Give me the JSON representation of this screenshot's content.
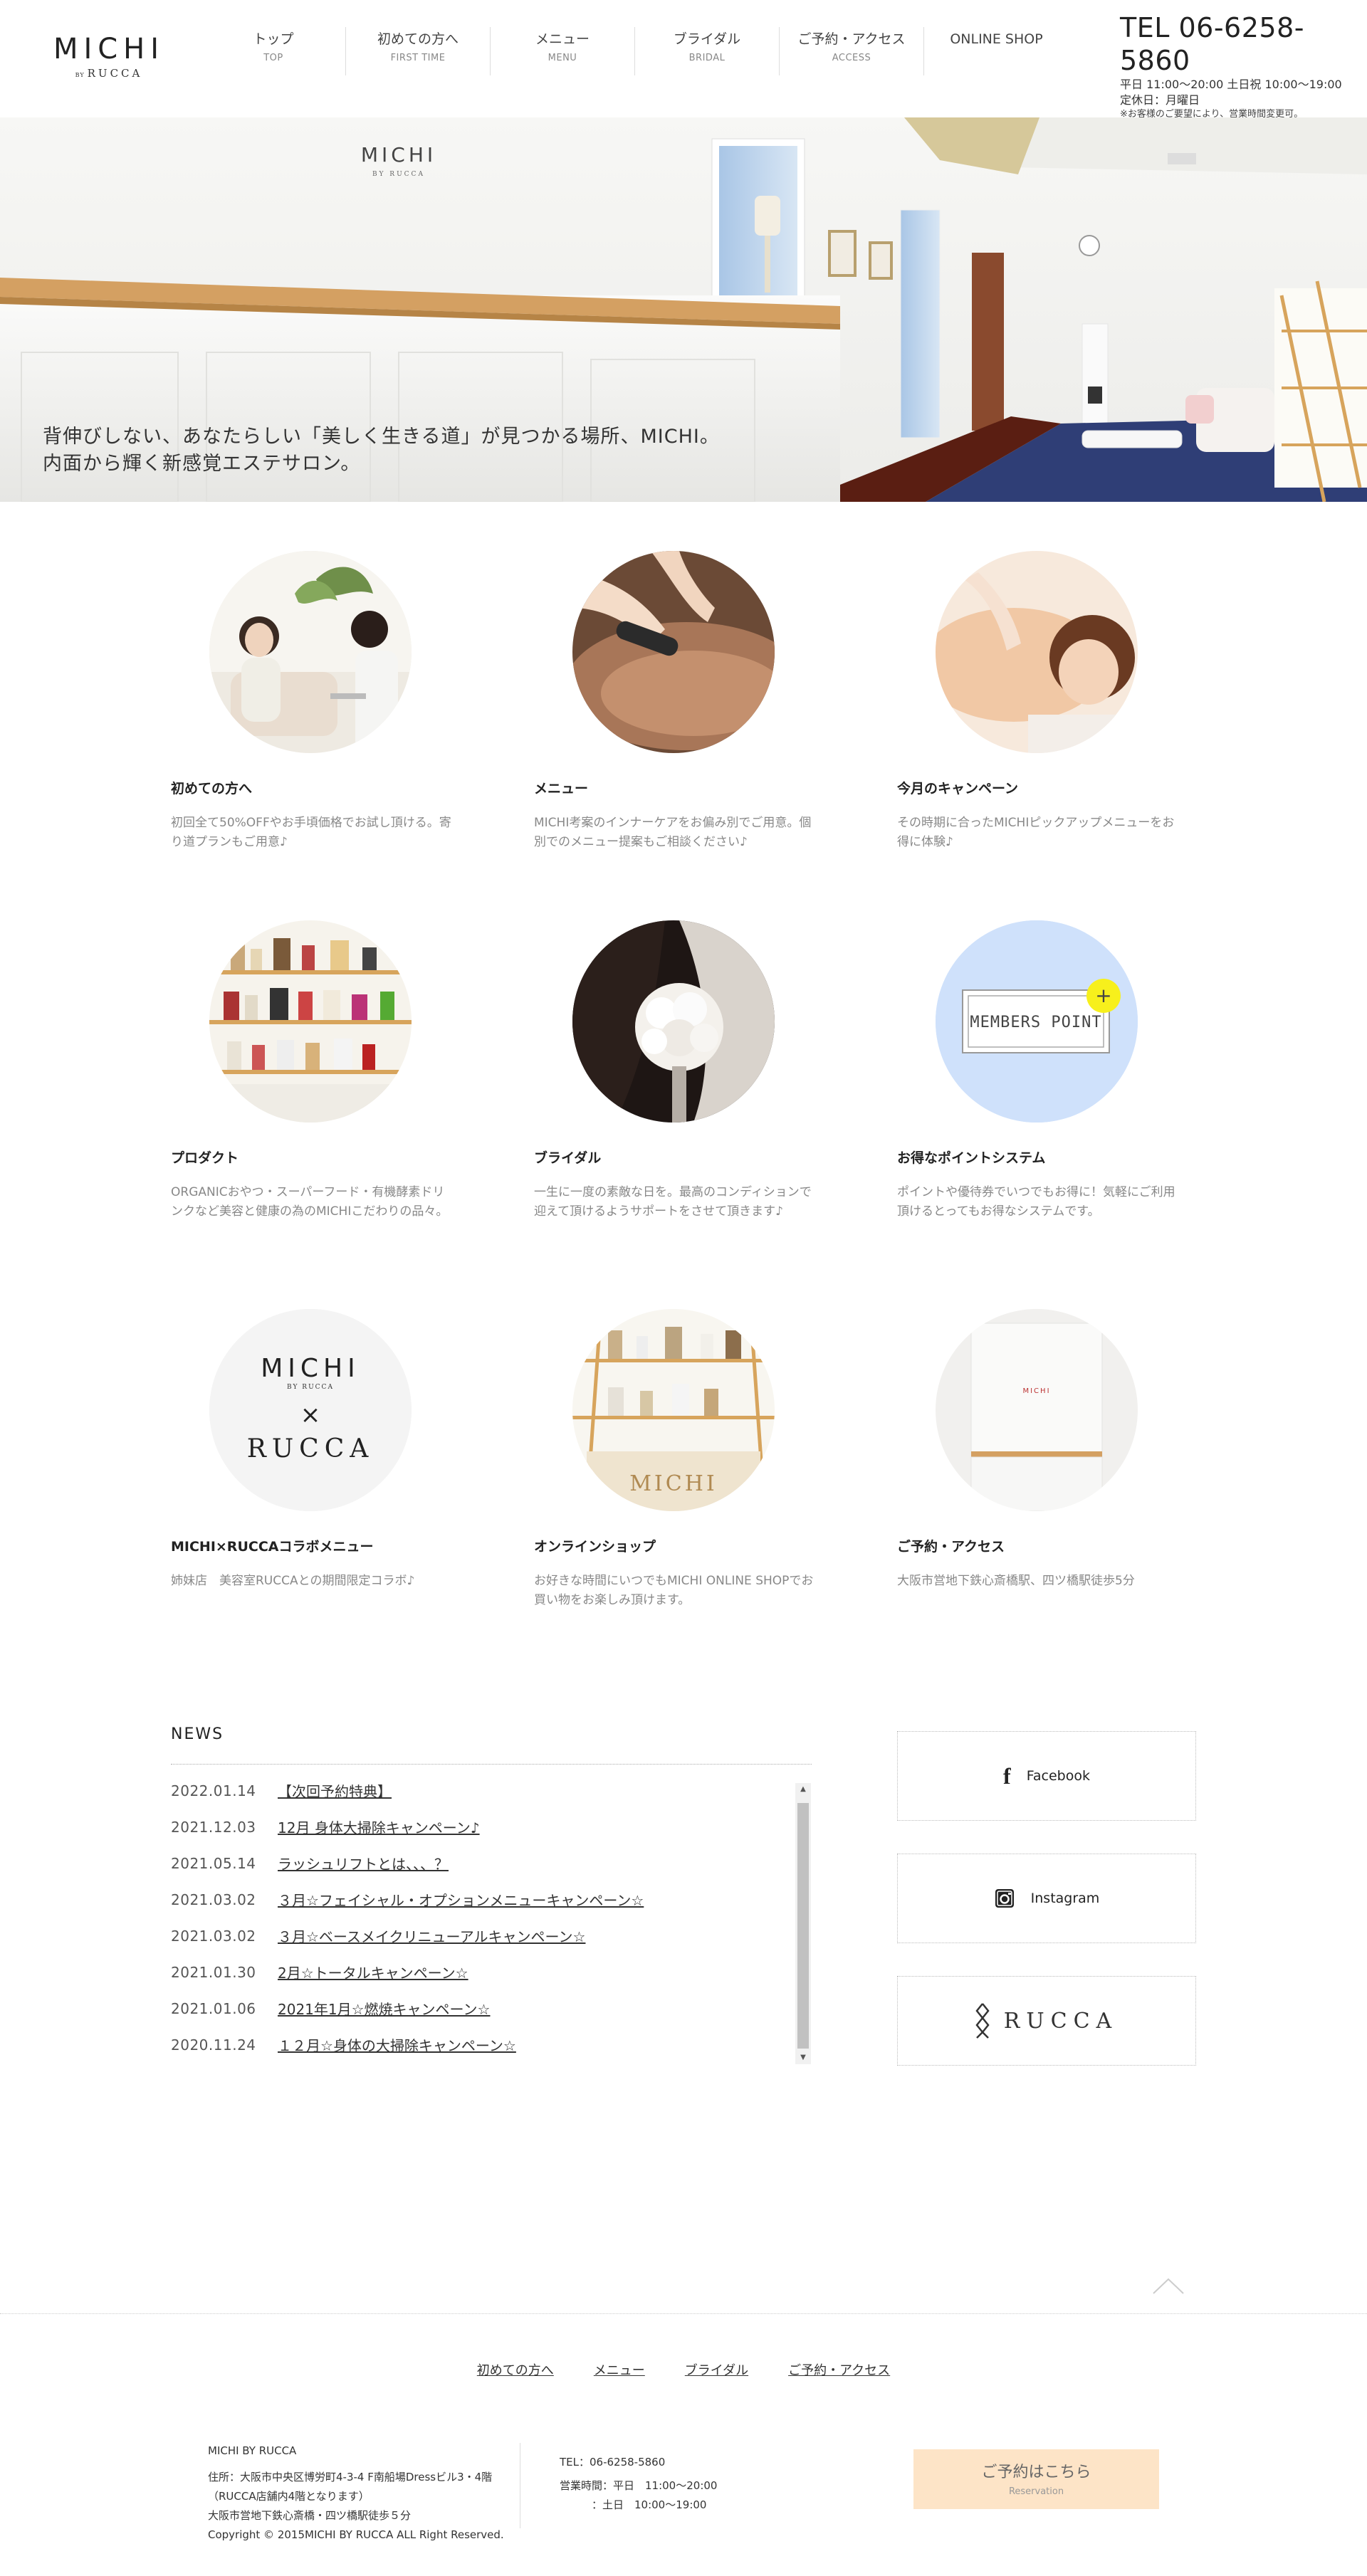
{
  "header": {
    "logo": "MICHI",
    "logo_by": "BY",
    "logo_sub": "RUCCA",
    "nav": [
      {
        "jp": "トップ",
        "en": "TOP"
      },
      {
        "jp": "初めての方へ",
        "en": "FIRST TIME"
      },
      {
        "jp": "メニュー",
        "en": "MENU"
      },
      {
        "jp": "ブライダル",
        "en": "BRIDAL"
      },
      {
        "jp": "ご予約・アクセス",
        "en": "ACCESS"
      },
      {
        "jp": "ONLINE SHOP",
        "en": ""
      }
    ],
    "tel": "TEL 06-6258-5860",
    "hours": "平日 11:00〜20:00 土日祝 10:00〜19:00",
    "holiday": "定休日：月曜日",
    "note": "※お客様のご要望により、営業時間変更可。"
  },
  "hero": {
    "wall_logo": "MICHI",
    "wall_logo_sub": "BY RUCCA",
    "line1": "背伸びしない、あなたらしい「美しく生きる道」が見つかる場所、MICHI。",
    "line2": "内面から輝く新感覚エステサロン。"
  },
  "grid": [
    {
      "title": "初めての方へ",
      "desc": "初回全て50%OFFやお手頃価格でお試し頂ける。寄り道プランもご用意♪"
    },
    {
      "title": "メニュー",
      "desc": "MICHI考案のインナーケアをお偏み別でご用意。個別でのメニュー提案もご相談ください♪"
    },
    {
      "title": "今月のキャンペーン",
      "desc": "その時期に合ったMICHIピックアップメニューをお得に体験♪"
    },
    {
      "title": "プロダクト",
      "desc": "ORGANICおやつ・スーパーフード・有機酵素ドリンクなど美容と健康の為のMICHIこだわりの品々。"
    },
    {
      "title": "ブライダル",
      "desc": "一生に一度の素敵な日を。最高のコンディションで迎えて頂けるようサポートをさせて頂きます♪"
    },
    {
      "title": "お得なポイントシステム",
      "desc": "ポイントや優待券でいつでもお得に！気軽にご利用頂けるとってもお得なシステムです。"
    },
    {
      "title": "MICHI×RUCCAコラボメニュー",
      "desc": "姉妹店　美容室RUCCAとの期間限定コラボ♪"
    },
    {
      "title": "オンラインショップ",
      "desc": "お好きな時間にいつでもMICHI ONLINE SHOPでお買い物をお楽しみ頂けます。"
    },
    {
      "title": "ご予約・アクセス",
      "desc": "大阪市営地下鉄心斎橋駅、四ツ橋駅徒歩5分"
    }
  ],
  "circles": {
    "members_point": "MEMBERS POINT",
    "members_plus": "+",
    "collab_top": "MICHI",
    "collab_by": "BY RUCCA",
    "collab_x": "×",
    "collab_bottom": "RUCCA",
    "online_sign": "MICHI",
    "access_sign": "MICHI"
  },
  "news": {
    "heading": "NEWS",
    "items": [
      {
        "date": "2022.01.14",
        "title": "【次回予約特典】"
      },
      {
        "date": "2021.12.03",
        "title": "12月 身体大掃除キャンペーン♪"
      },
      {
        "date": "2021.05.14",
        "title": "ラッシュリフトとは、、、？"
      },
      {
        "date": "2021.03.02",
        "title": "３月☆フェイシャル・オプションメニューキャンペーン☆"
      },
      {
        "date": "2021.03.02",
        "title": "３月☆ベースメイクリニューアルキャンペーン☆"
      },
      {
        "date": "2021.01.30",
        "title": "2月☆トータルキャンペーン☆"
      },
      {
        "date": "2021.01.06",
        "title": "2021年1月☆燃焼キャンペーン☆"
      },
      {
        "date": "2020.11.24",
        "title": "１２月☆身体の大掃除キャンペーン☆"
      }
    ],
    "scroll_up": "▲",
    "scroll_down": "▼"
  },
  "side": {
    "facebook": "Facebook",
    "facebook_glyph": "f",
    "instagram": "Instagram",
    "rucca": "RUCCA"
  },
  "footer": {
    "nav": [
      "初めての方へ",
      "メニュー",
      "ブライダル",
      "ご予約・アクセス"
    ],
    "company": "MICHI BY RUCCA",
    "address1": "住所：大阪市中央区博労町4-3-4 F南船場Dressビル3・4階",
    "address2": "（RUCCA店舗内4階となります）",
    "address3": "大阪市営地下鉄心斎橋・四ツ橋駅徒歩５分",
    "copyright": "Copyright © 2015MICHI BY RUCCA ALL Right Reserved.",
    "tel": "TEL：06-6258-5860",
    "hours1": "営業時間：平日　11:00〜20:00",
    "hours2": "　　　：土日　10:00〜19:00",
    "reserve_jp": "ご予約はこちら",
    "reserve_en": "Reservation"
  },
  "colors": {
    "reserve_bg": "#fde4c7",
    "members_bg": "#cfe1fb",
    "plus_badge": "#f7f01c",
    "shelf_wood": "#d7a45c"
  }
}
